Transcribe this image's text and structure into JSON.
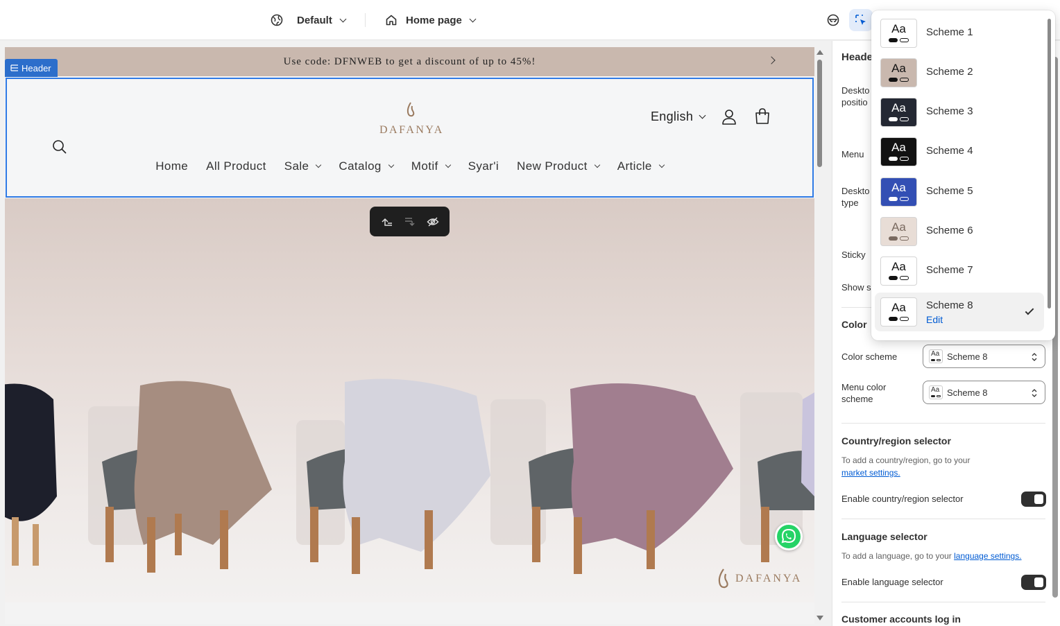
{
  "topbar": {
    "theme_label": "Default",
    "page_label": "Home page"
  },
  "preview": {
    "announcement": "Use code: DFNWEB to get a discount of up to 45%!",
    "section_tag": "Header",
    "logo_text": "DAFANYA",
    "language": "English",
    "nav": [
      {
        "label": "Home",
        "dropdown": false
      },
      {
        "label": "All Product",
        "dropdown": false
      },
      {
        "label": "Sale",
        "dropdown": true
      },
      {
        "label": "Catalog",
        "dropdown": true
      },
      {
        "label": "Motif",
        "dropdown": true
      },
      {
        "label": "Syar'i",
        "dropdown": false
      },
      {
        "label": "New Product",
        "dropdown": true
      },
      {
        "label": "Article",
        "dropdown": true
      }
    ],
    "hero_logo_text": "DAFANYA"
  },
  "panel": {
    "section_title": "Heade",
    "desktop_position_label": "Deskto positio",
    "menu_label": "Menu",
    "desktop_type_label": "Deskto type",
    "sticky_label": "Sticky",
    "show_label": "Show s",
    "color_title": "Color",
    "color_scheme_label": "Color scheme",
    "color_scheme_value": "Scheme 8",
    "menu_color_scheme_label": "Menu color scheme",
    "menu_color_scheme_value": "Scheme 8",
    "country_title": "Country/region selector",
    "country_hint": "To add a country/region, go to your",
    "country_link": "market settings.",
    "country_toggle_label": "Enable country/region selector",
    "language_title": "Language selector",
    "language_hint": "To add a language, go to your",
    "language_link": "language settings.",
    "language_toggle_label": "Enable language selector",
    "customer_title": "Customer accounts log in"
  },
  "dropdown": {
    "items": [
      {
        "label": "Scheme 1",
        "bg": "#ffffff",
        "fg": "#121212"
      },
      {
        "label": "Scheme 2",
        "bg": "#c9b8ae",
        "fg": "#121212"
      },
      {
        "label": "Scheme 3",
        "bg": "#242833",
        "fg": "#ffffff"
      },
      {
        "label": "Scheme 4",
        "bg": "#121212",
        "fg": "#ffffff"
      },
      {
        "label": "Scheme 5",
        "bg": "#334fb4",
        "fg": "#ffffff"
      },
      {
        "label": "Scheme 6",
        "bg": "#e8ddd6",
        "fg": "#7a6a60"
      },
      {
        "label": "Scheme 7",
        "bg": "#ffffff",
        "fg": "#121212"
      },
      {
        "label": "Scheme 8",
        "bg": "#ffffff",
        "fg": "#121212"
      }
    ],
    "selected_index": 7,
    "edit_label": "Edit"
  },
  "colors": {
    "accent": "#2c6ecb",
    "link": "#005bd3",
    "announcement_bg": "#c9b8ae",
    "header_bg": "#f5f6f7",
    "logo_gold": "#9a7a5f"
  }
}
